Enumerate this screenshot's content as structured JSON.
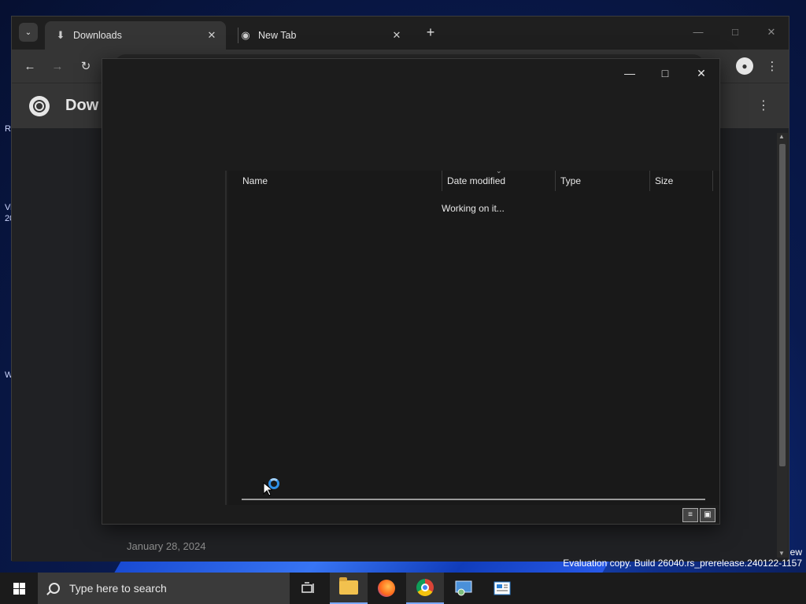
{
  "desktop": {
    "side_labels": [
      "R",
      "Vi",
      "20",
      "W"
    ],
    "watermark_line1": "ew",
    "watermark_line2": "Evaluation copy. Build 26040.rs_prerelease.240122-1157"
  },
  "browser": {
    "tabs": [
      {
        "label": "Downloads",
        "icon": "download-icon",
        "active": true
      },
      {
        "label": "New Tab",
        "icon": "chrome-icon",
        "active": false
      }
    ],
    "page_title": "Downloads",
    "page_title_visible": "Dow",
    "date_header": "January 28, 2024"
  },
  "dialog": {
    "columns": [
      {
        "label": "Name"
      },
      {
        "label": "Date modified"
      },
      {
        "label": "Type"
      },
      {
        "label": "Size"
      }
    ],
    "status_text": "Working on it...",
    "sorted_column": "Date modified"
  },
  "taskbar": {
    "search_placeholder": "Type here to search",
    "apps": [
      "task-view-icon",
      "file-explorer-icon",
      "firefox-icon",
      "chrome-icon",
      "network-app-icon",
      "news-app-icon"
    ],
    "active_app": "file-explorer-icon"
  },
  "colors": {
    "accent": "#2e8fe6",
    "taskbar": "#1b1b1b",
    "dialog_bg": "#1c1c1c"
  }
}
